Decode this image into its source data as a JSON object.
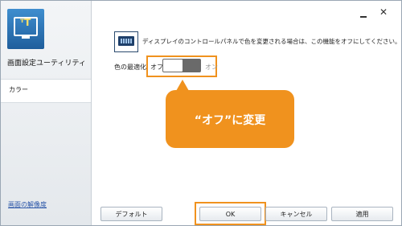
{
  "sidebar": {
    "app_name": "画面設定ユーティリティ",
    "items": [
      {
        "label": "カラー"
      }
    ],
    "bottom_link": "画面の解像度"
  },
  "window_controls": {
    "minimize": "–",
    "close": "✕"
  },
  "main": {
    "description": "ディスプレイのコントロールパネルで色を変更される場合は、この機能をオフにしてください。",
    "option_label": "色の最適化",
    "toggle": {
      "off_label": "オフ",
      "on_label": "オン",
      "state": "off"
    }
  },
  "callout": {
    "text": "“オフ”に変更",
    "color": "#f0921e"
  },
  "buttons": {
    "default": "デフォルト",
    "ok": "OK",
    "cancel": "キャンセル",
    "apply": "適用"
  },
  "colors": {
    "accent": "#f0921e",
    "link": "#2b56a8"
  }
}
